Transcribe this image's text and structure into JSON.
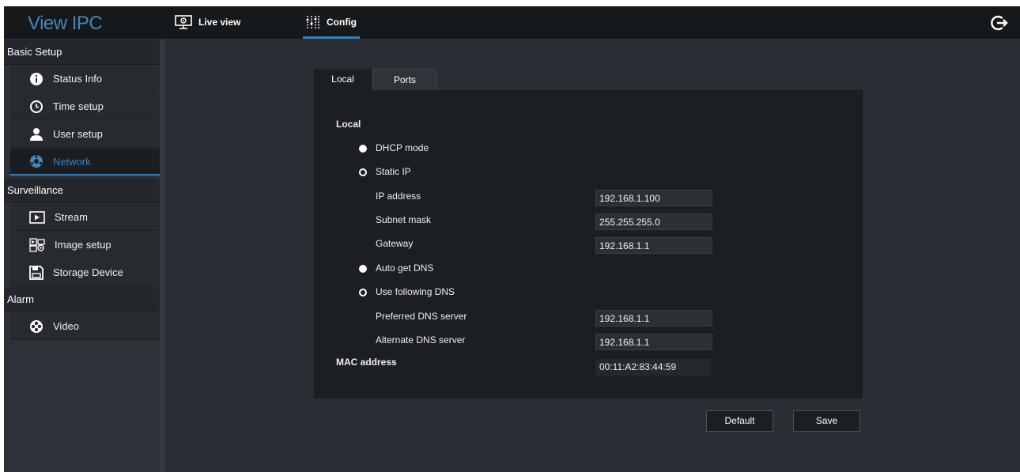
{
  "app": {
    "title": "View IPC"
  },
  "nav": {
    "live_view": "Live view",
    "config": "Config"
  },
  "sidebar": {
    "sections": [
      {
        "label": "Basic Setup",
        "items": [
          {
            "label": "Status Info",
            "icon": "info-icon"
          },
          {
            "label": "Time setup",
            "icon": "clock-icon"
          },
          {
            "label": "User setup",
            "icon": "user-icon"
          },
          {
            "label": "Network",
            "icon": "network-icon",
            "active": true
          }
        ]
      },
      {
        "label": "Surveillance",
        "items": [
          {
            "label": "Stream",
            "icon": "play-icon"
          },
          {
            "label": "Image setup",
            "icon": "image-settings-icon"
          },
          {
            "label": "Storage Device",
            "icon": "floppy-icon"
          }
        ]
      },
      {
        "label": "Alarm",
        "items": [
          {
            "label": "Video",
            "icon": "video-alarm-icon"
          }
        ]
      }
    ]
  },
  "tabs": {
    "local": "Local",
    "ports": "Ports",
    "active": "Local"
  },
  "form": {
    "section_title": "Local",
    "dhcp_mode": {
      "label": "DHCP mode",
      "selected": true
    },
    "static_ip": {
      "label": "Static IP",
      "selected": false
    },
    "ip_address": {
      "label": "IP address",
      "value": "192.168.1.100"
    },
    "subnet_mask": {
      "label": "Subnet mask",
      "value": "255.255.255.0"
    },
    "gateway": {
      "label": "Gateway",
      "value": "192.168.1.1"
    },
    "auto_dns": {
      "label": "Auto get DNS",
      "selected": true
    },
    "use_dns": {
      "label": "Use following DNS",
      "selected": false
    },
    "preferred_dns": {
      "label": "Preferred DNS server",
      "value": "192.168.1.1"
    },
    "alternate_dns": {
      "label": "Alternate DNS server",
      "value": "192.168.1.1"
    },
    "mac": {
      "label": "MAC address",
      "value": "00:11:A2:83:44:59"
    }
  },
  "buttons": {
    "default": "Default",
    "save": "Save"
  },
  "colors": {
    "accent": "#2e7fc1",
    "logo": "#4a84b6",
    "panel": "#1b1e22",
    "background": "#2a2e34"
  }
}
